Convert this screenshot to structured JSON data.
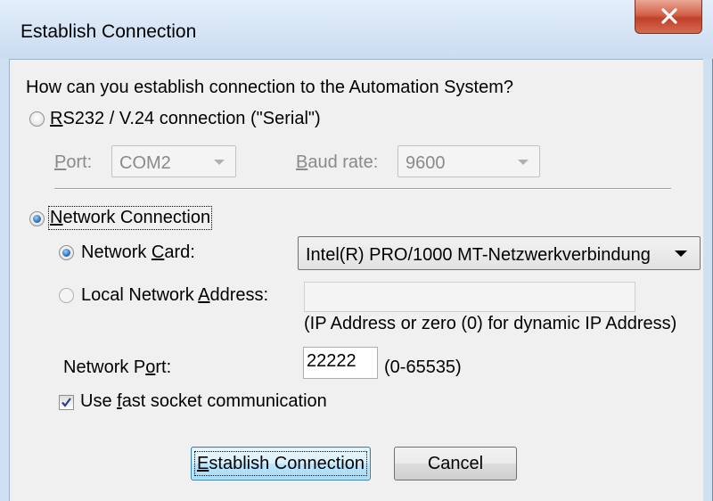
{
  "window": {
    "title": "Establish Connection",
    "close_label": "X"
  },
  "prompt": "How can you establish connection to the Automation System?",
  "serial": {
    "label_pre": "",
    "label_u": "R",
    "label_post": "S232 / V.24 connection (\"Serial\")",
    "port_label_u": "P",
    "port_label_post": "ort:",
    "port_value": "COM2",
    "baud_label_u": "B",
    "baud_label_post": "aud rate:",
    "baud_value": "9600",
    "selected": false
  },
  "network": {
    "label_u": "N",
    "label_post": "etwork Connection",
    "selected": true,
    "card_label_pre": "Network ",
    "card_label_u": "C",
    "card_label_post": "ard:",
    "card_selected": true,
    "card_value": "Intel(R) PRO/1000 MT-Netzwerkverbindung",
    "local_label_pre": "Local Network ",
    "local_label_u": "A",
    "local_label_post": "ddress:",
    "local_value": "",
    "ip_hint": "(IP Address or zero (0) for dynamic IP Address)",
    "port_label_pre": "Network P",
    "port_label_u": "o",
    "port_label_post": "rt:",
    "port_value": "22222",
    "port_range": "(0-65535)",
    "fast_pre": "Use ",
    "fast_u": "f",
    "fast_post": "ast socket communication",
    "fast_checked": true
  },
  "buttons": {
    "connect_u": "E",
    "connect_post": "stablish Connection",
    "cancel": "Cancel"
  }
}
